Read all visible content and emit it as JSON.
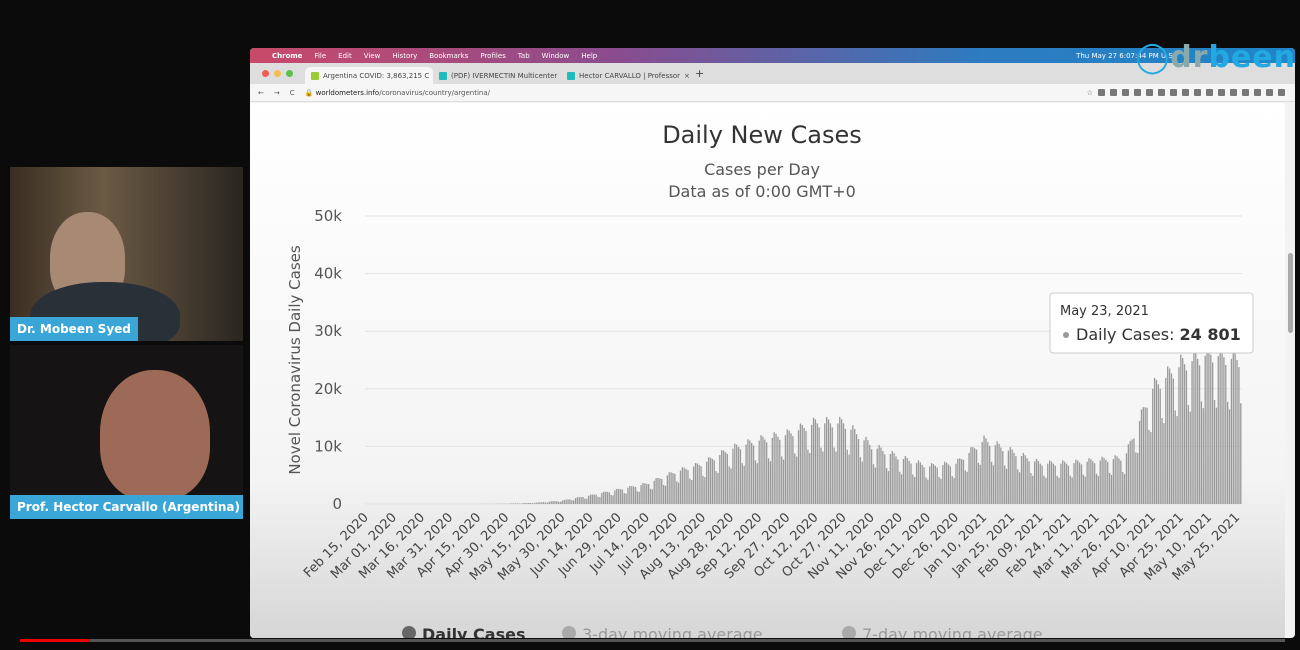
{
  "participants": [
    {
      "name": "Dr. Mobeen Syed"
    },
    {
      "name": "Prof. Hector Carvallo (Argentina)"
    }
  ],
  "brand": {
    "logo": "drbeen",
    "color": "#23a9e1"
  },
  "menubar": {
    "items": [
      "Chrome",
      "File",
      "Edit",
      "View",
      "History",
      "Bookmarks",
      "Profiles",
      "Tab",
      "Window",
      "Help"
    ],
    "clock": "Thu May 27  6:07:44 PM",
    "locale": "U.S."
  },
  "tabs": [
    {
      "title": "Argentina COVID: 3,863,215 C"
    },
    {
      "title": "(PDF) IVERMECTIN Multicenter"
    },
    {
      "title": "Hector CARVALLO | Professor"
    }
  ],
  "url": {
    "host": "worldometers.info",
    "path": "/coronavirus/country/argentina/"
  },
  "chart_data": {
    "type": "bar",
    "title": "Daily New Cases",
    "subtitle": [
      "Cases per Day",
      "Data as of 0:00 GMT+0"
    ],
    "ylabel": "Novel Coronavirus Daily Cases",
    "ylim": [
      0,
      50000
    ],
    "yticks": [
      "0",
      "10k",
      "20k",
      "30k",
      "40k",
      "50k"
    ],
    "grid": true,
    "color": "#999999",
    "x": [
      "Feb 15, 2020",
      "Mar 01, 2020",
      "Mar 16, 2020",
      "Mar 31, 2020",
      "Apr 15, 2020",
      "Apr 30, 2020",
      "May 15, 2020",
      "May 30, 2020",
      "Jun 14, 2020",
      "Jun 29, 2020",
      "Jul 14, 2020",
      "Jul 29, 2020",
      "Aug 13, 2020",
      "Aug 28, 2020",
      "Sep 12, 2020",
      "Sep 27, 2020",
      "Oct 12, 2020",
      "Oct 27, 2020",
      "Nov 11, 2020",
      "Nov 26, 2020",
      "Dec 11, 2020",
      "Dec 26, 2020",
      "Jan 10, 2021",
      "Jan 25, 2021",
      "Feb 09, 2021",
      "Feb 24, 2021",
      "Mar 11, 2021",
      "Mar 26, 2021",
      "Apr 10, 2021",
      "Apr 25, 2021",
      "May 10, 2021",
      "May 25, 2021"
    ],
    "values": [
      0,
      0,
      0,
      0,
      0,
      50,
      200,
      600,
      1500,
      2500,
      3500,
      5500,
      7000,
      9500,
      11000,
      12000,
      14000,
      14000,
      10000,
      8000,
      6500,
      7000,
      11000,
      9000,
      7000,
      7000,
      7500,
      8000,
      20000,
      24000,
      26000,
      25000
    ],
    "tooltip": {
      "date": "May 23, 2021",
      "label": "Daily Cases: ",
      "value": "24 801"
    },
    "legend": [
      "Daily Cases",
      "3-day moving average",
      "7-day moving average"
    ],
    "legend_position": "bottom"
  }
}
